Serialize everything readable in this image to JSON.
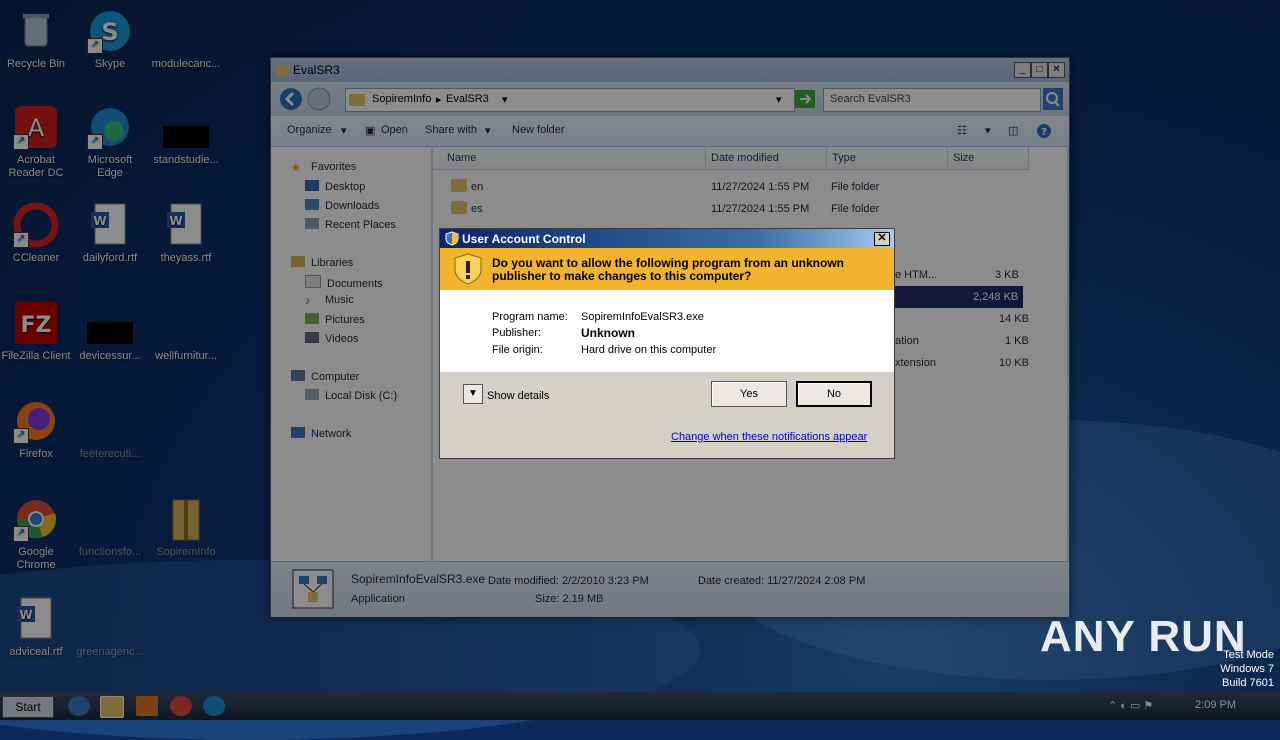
{
  "desktop": {
    "icons": [
      {
        "label": "Recycle Bin"
      },
      {
        "label": "Skype"
      },
      {
        "label": "modulecanc..."
      },
      {
        "label": "Acrobat Reader DC"
      },
      {
        "label": "Microsoft Edge"
      },
      {
        "label": "standstudie..."
      },
      {
        "label": "CCleaner"
      },
      {
        "label": "dailyford.rtf"
      },
      {
        "label": "theyass.rtf"
      },
      {
        "label": "FileZilla Client"
      },
      {
        "label": "devicessur..."
      },
      {
        "label": "wellfurnitur..."
      },
      {
        "label": "Firefox"
      },
      {
        "label": "feeterecuti..."
      },
      {
        "label": "Google Chrome"
      },
      {
        "label": "functionsfo..."
      },
      {
        "label": "SopiremInfo"
      },
      {
        "label": "adviceal.rtf"
      },
      {
        "label": "greenagenc..."
      }
    ]
  },
  "explorer": {
    "title": "EvalSR3",
    "breadcrumb": [
      "SopiremInfo",
      "EvalSR3"
    ],
    "search_placeholder": "Search EvalSR3",
    "toolbar": {
      "organize": "Organize",
      "open": "Open",
      "share_with": "Share with",
      "new_folder": "New folder"
    },
    "nav": {
      "favorites": "Favorites",
      "desktop": "Desktop",
      "downloads": "Downloads",
      "recent": "Recent Places",
      "libraries": "Libraries",
      "documents": "Documents",
      "music": "Music",
      "pictures": "Pictures",
      "videos": "Videos",
      "computer": "Computer",
      "local_disk": "Local Disk (C:)",
      "network": "Network"
    },
    "columns": {
      "name": "Name",
      "date": "Date modified",
      "type": "Type",
      "size": "Size"
    },
    "rows": [
      {
        "name": "en",
        "date": "11/27/2024 1:55 PM",
        "type": "File folder",
        "size": ""
      },
      {
        "name": "es",
        "date": "11/27/2024 1:55 PM",
        "type": "File folder",
        "size": ""
      },
      {
        "name": "",
        "date": "",
        "type": "e HTM...",
        "size": "3 KB"
      },
      {
        "name": "",
        "date": "",
        "type": "",
        "size": "2,248 KB"
      },
      {
        "name": "",
        "date": "",
        "type": "",
        "size": "14 KB"
      },
      {
        "name": "",
        "date": "",
        "type": "ation",
        "size": "1 KB"
      },
      {
        "name": "",
        "date": "",
        "type": "xtension",
        "size": "10 KB"
      }
    ],
    "details": {
      "filename": "SopiremInfoEvalSR3.exe",
      "kind": "Application",
      "date_modified": "Date modified: 2/2/2010 3:23 PM",
      "size": "Size: 2.19 MB",
      "date_created": "Date created: 11/27/2024 2:08 PM"
    }
  },
  "uac": {
    "title": "User Account Control",
    "question": "Do you want to allow the following program from an unknown publisher to make changes to this computer?",
    "program_name_label": "Program name:",
    "program_name": "SopiremInfoEvalSR3.exe",
    "publisher_label": "Publisher:",
    "publisher": "Unknown",
    "file_origin_label": "File origin:",
    "file_origin": "Hard drive on this computer",
    "show_details": "Show details",
    "yes": "Yes",
    "no": "No",
    "change_link": "Change when these notifications appear"
  },
  "taskbar": {
    "start": "Start",
    "clock": "2:09 PM"
  },
  "watermark": {
    "brand": "ANY RUN",
    "test_mode": "Test Mode",
    "os": "Windows 7",
    "build": "Build 7601"
  },
  "colors": {
    "uac_banner": "#f2b42f",
    "uac_title": "#0a246a",
    "selection": "#1e2a6a"
  }
}
